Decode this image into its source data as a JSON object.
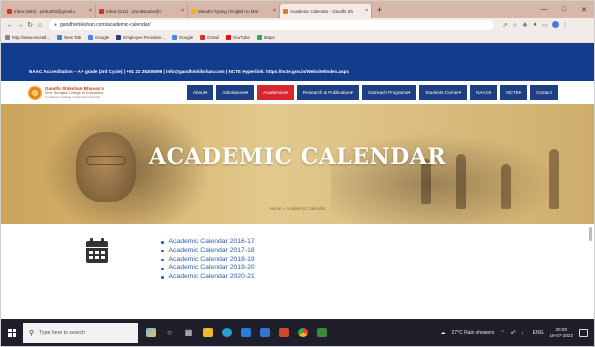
{
  "browser": {
    "tabs": [
      {
        "label": "Inbox (664) - pintu203@gmail.c",
        "color": "#d93025"
      },
      {
        "label": "Inbox (612) - pmu9saobe@c",
        "color": "#d93025"
      },
      {
        "label": "Marathi Typing | English to Mar",
        "color": "#f4b400"
      },
      {
        "label": "Academic Calendar - Gandhi Sh",
        "color": "#e37b1f",
        "active": true
      }
    ],
    "new_tab": "+",
    "window_controls": [
      "—",
      "□",
      "✕"
    ],
    "nav": {
      "back": "←",
      "forward": "→",
      "reload": "↻",
      "home": "⌂"
    },
    "url": "gandhishikshan.com/academic-calendar/",
    "bookmarks": [
      {
        "label": "http://www.mcetdl...",
        "color": "#888888"
      },
      {
        "label": "New Tab",
        "color": "#4a7bd3"
      },
      {
        "label": "Google",
        "color": "#4285f4"
      },
      {
        "label": "Employee Providen...",
        "color": "#1f3f83"
      },
      {
        "label": "Google",
        "color": "#4285f4"
      },
      {
        "label": "Gmail",
        "color": "#d93025"
      },
      {
        "label": "YouTube",
        "color": "#ff0000"
      },
      {
        "label": "Maps",
        "color": "#34a853"
      }
    ]
  },
  "site": {
    "topbar_text": "NAAC Accreditation – A+ grade (3rd Cycle) | +91 22 26200599 | info@gandhishikshan.com | NCTE Hyperlink: https://ncte.gov.in/Website/Index.aspx",
    "logo": {
      "line1": "Gandhi Shikshan Bhavan's",
      "line2": "Smt. Surajba College of Education",
      "line3": "Constituent College of Mumbai University"
    },
    "nav": [
      {
        "label": "About",
        "arrow": true
      },
      {
        "label": "Admissions",
        "arrow": true
      },
      {
        "label": "Academics",
        "arrow": true,
        "active": true
      },
      {
        "label": "Research & Publication",
        "arrow": true
      },
      {
        "label": "Outreach Programs",
        "arrow": true
      },
      {
        "label": "Students Corner",
        "arrow": true
      },
      {
        "label": "NAAC",
        "arrow": true
      },
      {
        "label": "NCTE",
        "arrow": true
      },
      {
        "label": "Contact",
        "arrow": false
      }
    ],
    "banner_title": "ACADEMIC CALENDAR",
    "breadcrumb": "Home » Academic Calendar",
    "calendar_links": [
      "Academic Calendar 2016-17",
      "Academic Calendar 2017-18",
      "Academic Calendar 2018-19",
      "Academic Calendar 2019-20",
      "Academic Calendar 2020-21"
    ]
  },
  "taskbar": {
    "search_placeholder": "Type here to search",
    "weather": "27°C  Rain showers",
    "language": "ENG",
    "time": "20:00",
    "date": "19-07-2022"
  }
}
